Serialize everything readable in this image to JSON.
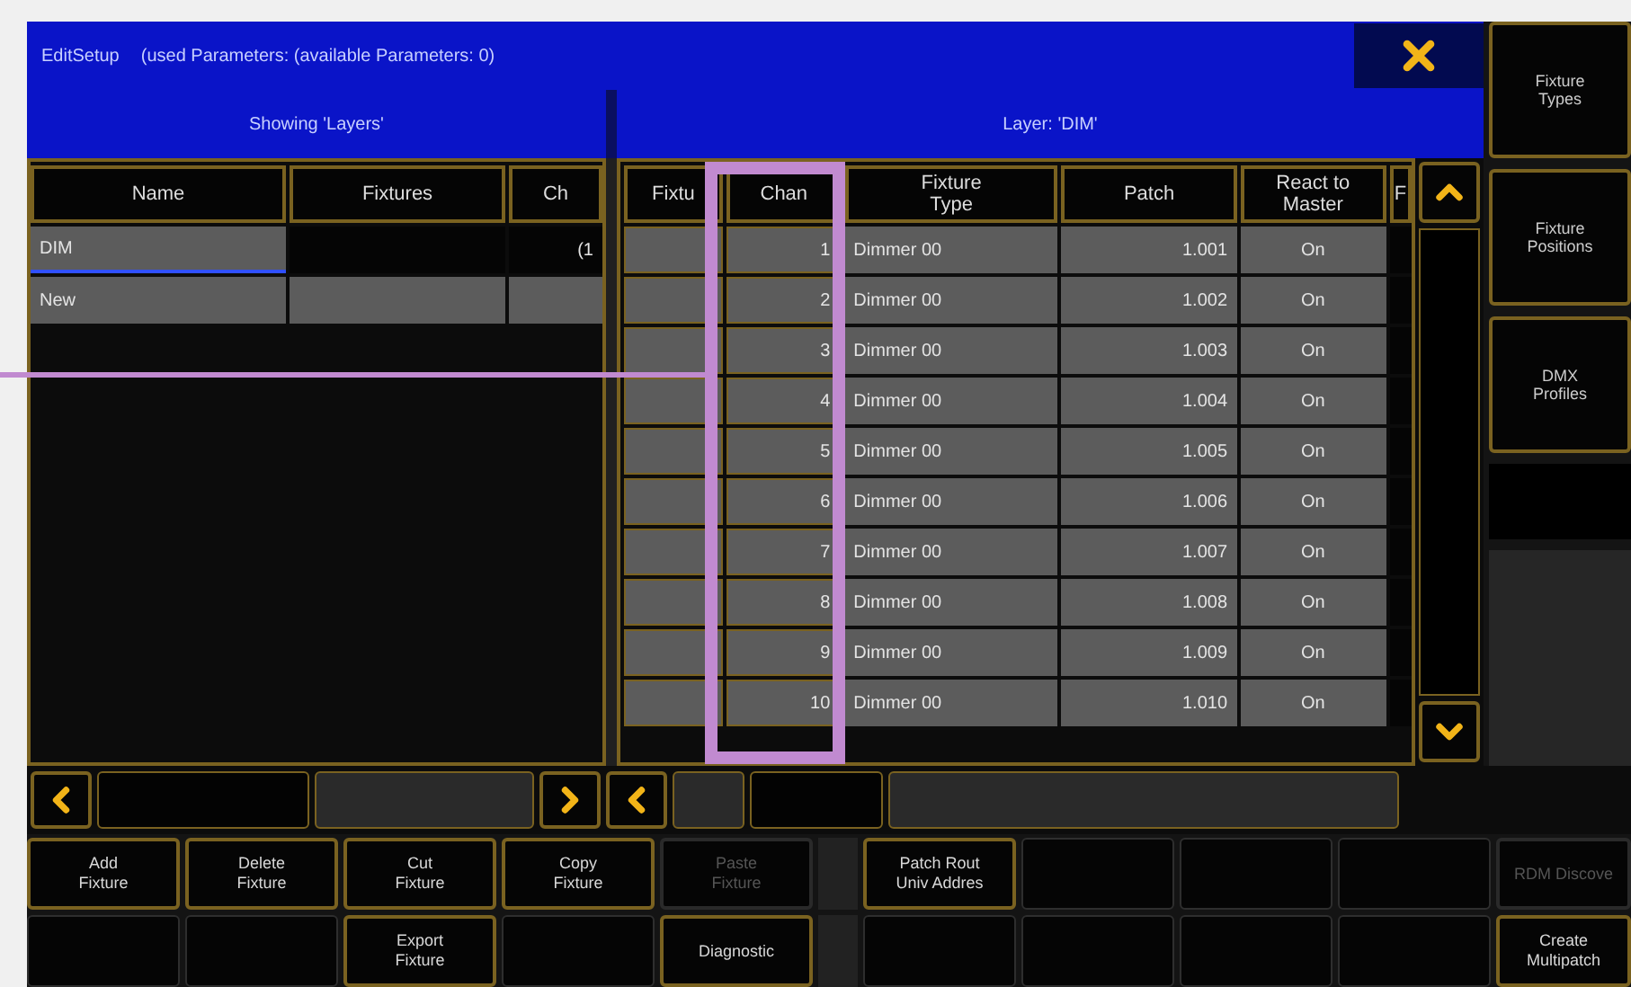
{
  "title_bar": {
    "title": "EditSetup",
    "info": "(used Parameters: (available Parameters: 0)"
  },
  "left_panel": {
    "heading": "Showing 'Layers'",
    "columns": [
      "Name",
      "Fixtures",
      "Ch"
    ],
    "rows": [
      {
        "name": "DIM",
        "channels": "(1",
        "selected": true
      },
      {
        "name": "New",
        "selected": false
      }
    ]
  },
  "right_panel": {
    "heading": "Layer: 'DIM'",
    "columns": [
      "Fixtu",
      "Chan",
      "Fixture\nType",
      "Patch",
      "React to\nMaster",
      "F"
    ],
    "rows": [
      {
        "channel": "1",
        "type": "Dimmer 00",
        "patch": "1.001",
        "react": "On"
      },
      {
        "channel": "2",
        "type": "Dimmer 00",
        "patch": "1.002",
        "react": "On"
      },
      {
        "channel": "3",
        "type": "Dimmer 00",
        "patch": "1.003",
        "react": "On"
      },
      {
        "channel": "4",
        "type": "Dimmer 00",
        "patch": "1.004",
        "react": "On"
      },
      {
        "channel": "5",
        "type": "Dimmer 00",
        "patch": "1.005",
        "react": "On"
      },
      {
        "channel": "6",
        "type": "Dimmer 00",
        "patch": "1.006",
        "react": "On"
      },
      {
        "channel": "7",
        "type": "Dimmer 00",
        "patch": "1.007",
        "react": "On"
      },
      {
        "channel": "8",
        "type": "Dimmer 00",
        "patch": "1.008",
        "react": "On"
      },
      {
        "channel": "9",
        "type": "Dimmer 00",
        "patch": "1.009",
        "react": "On"
      },
      {
        "channel": "10",
        "type": "Dimmer 00",
        "patch": "1.010",
        "react": "On"
      }
    ]
  },
  "side_buttons": [
    "Fixture\nTypes",
    "Fixture\nPositions",
    "DMX\nProfiles"
  ],
  "button_rows": [
    [
      {
        "kind": "button",
        "label": "Add\nFixture",
        "disabled": false
      },
      {
        "kind": "button",
        "label": "Delete\nFixture",
        "disabled": false
      },
      {
        "kind": "button",
        "label": "Cut\nFixture",
        "disabled": false
      },
      {
        "kind": "button",
        "label": "Copy\nFixture",
        "disabled": false
      },
      {
        "kind": "button",
        "label": "Paste\nFixture",
        "disabled": true
      },
      {
        "kind": "button",
        "label": "Patch Rout\nUniv Addres",
        "disabled": false
      },
      {
        "kind": "empty"
      },
      {
        "kind": "empty"
      },
      {
        "kind": "empty"
      },
      {
        "kind": "button",
        "label": "RDM Discove",
        "disabled": true
      }
    ],
    [
      {
        "kind": "empty"
      },
      {
        "kind": "empty"
      },
      {
        "kind": "button",
        "label": "Export\nFixture",
        "disabled": false
      },
      {
        "kind": "empty"
      },
      {
        "kind": "button",
        "label": "Diagnostic",
        "disabled": false
      },
      {
        "kind": "empty"
      },
      {
        "kind": "empty"
      },
      {
        "kind": "empty"
      },
      {
        "kind": "empty"
      },
      {
        "kind": "button",
        "label": "Create\nMultipatch",
        "disabled": false
      }
    ]
  ]
}
